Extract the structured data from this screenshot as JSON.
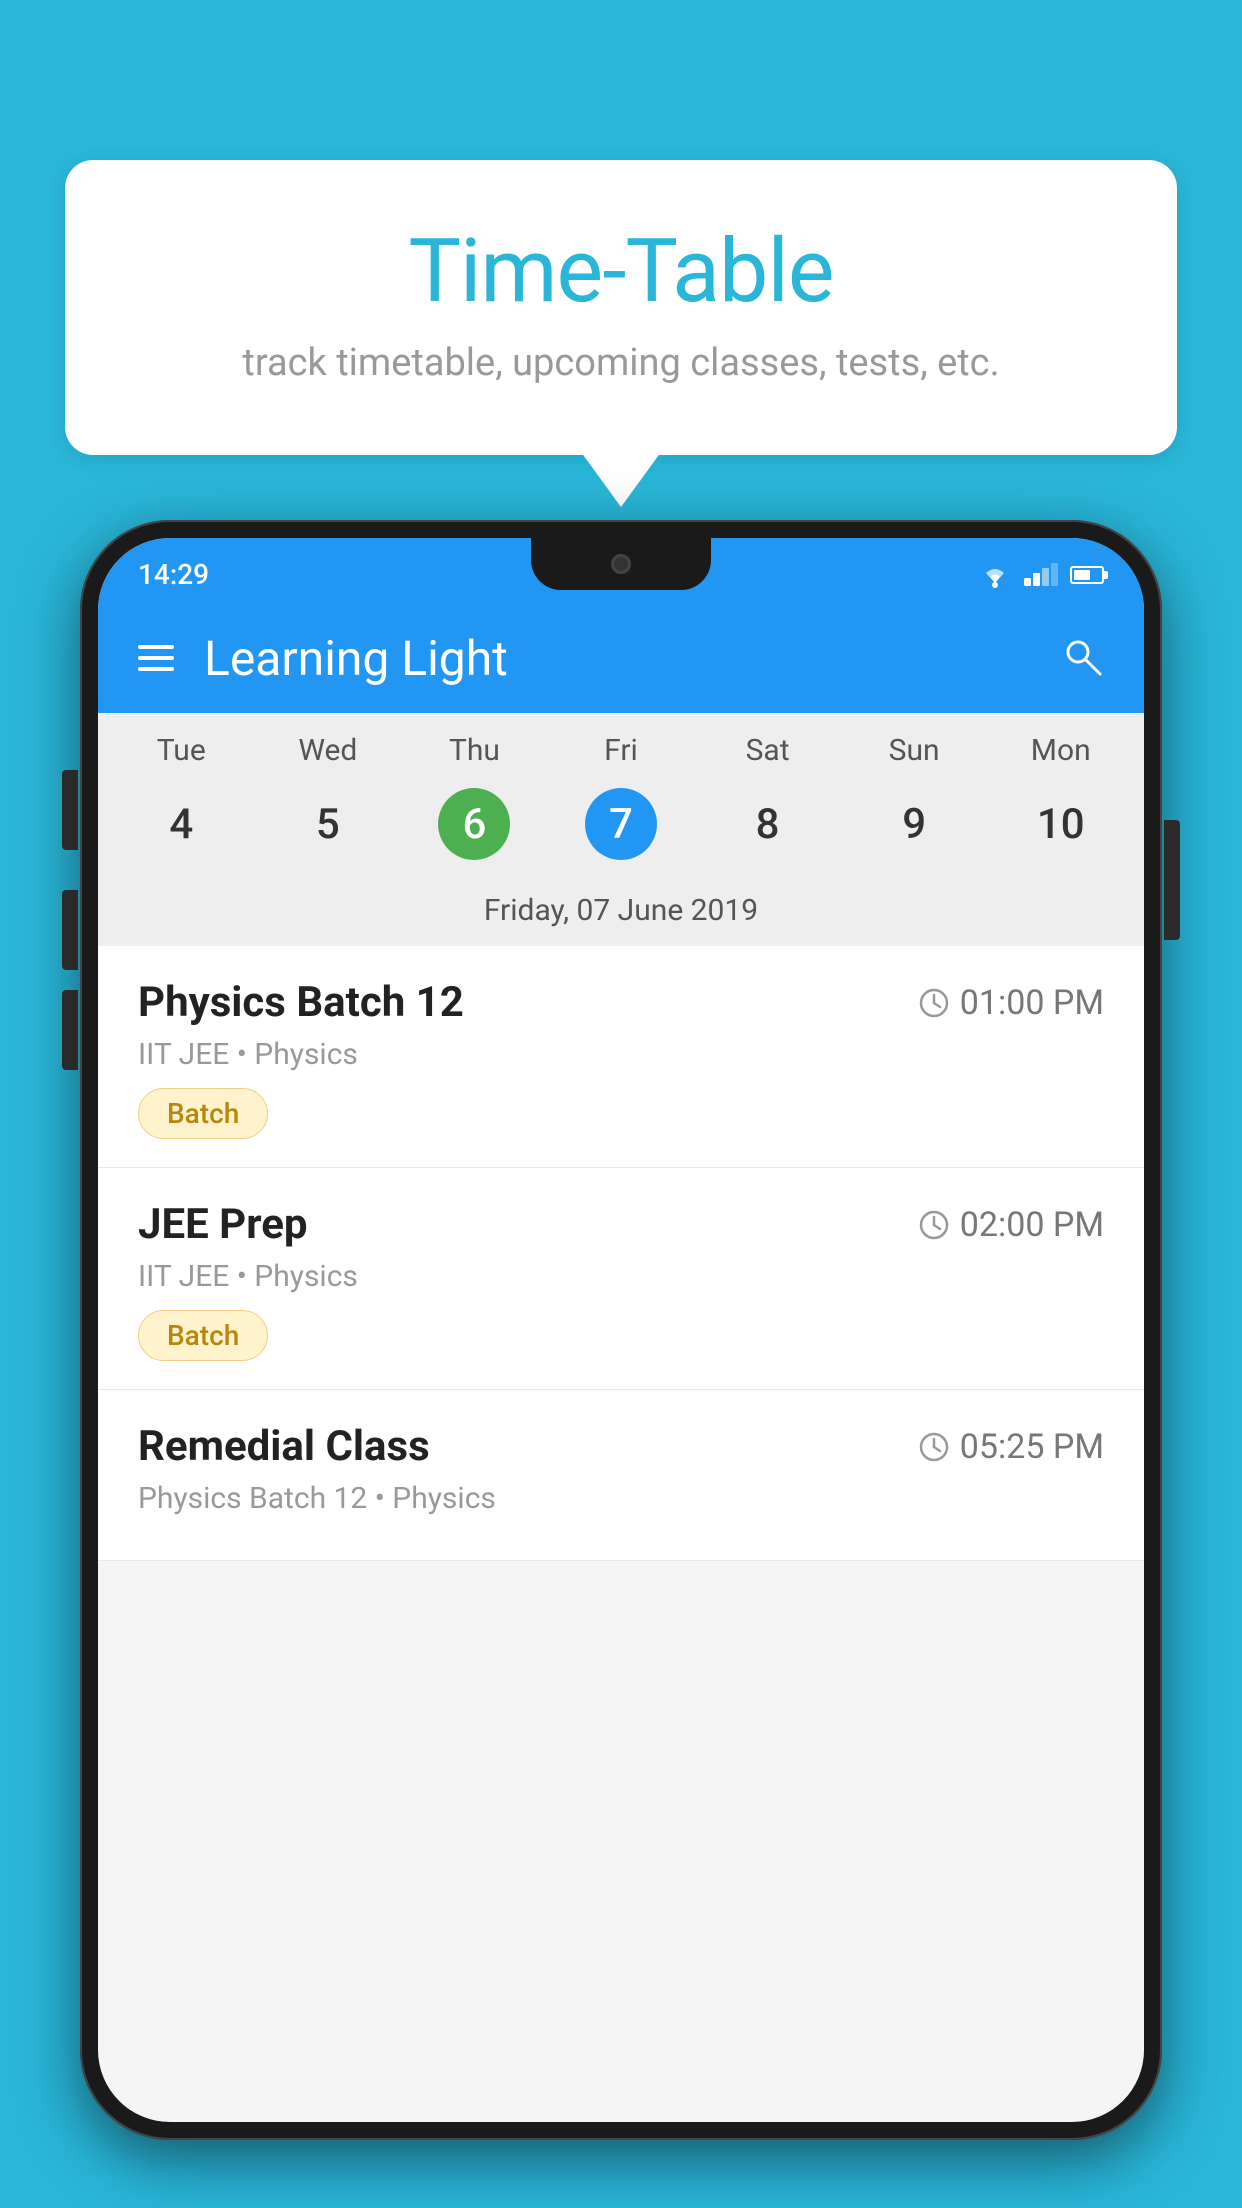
{
  "page": {
    "background_color": "#29B6D8"
  },
  "speech_bubble": {
    "title": "Time-Table",
    "subtitle": "track timetable, upcoming classes, tests, etc."
  },
  "phone": {
    "status_bar": {
      "time": "14:29"
    },
    "app_bar": {
      "title": "Learning Light"
    },
    "calendar": {
      "day_headers": [
        "Tue",
        "Wed",
        "Thu",
        "Fri",
        "Sat",
        "Sun",
        "Mon"
      ],
      "day_numbers": [
        {
          "num": "4",
          "type": "normal"
        },
        {
          "num": "5",
          "type": "normal"
        },
        {
          "num": "6",
          "type": "green"
        },
        {
          "num": "7",
          "type": "blue"
        },
        {
          "num": "8",
          "type": "normal"
        },
        {
          "num": "9",
          "type": "normal"
        },
        {
          "num": "10",
          "type": "normal"
        }
      ],
      "selected_date": "Friday, 07 June 2019"
    },
    "schedule_items": [
      {
        "title": "Physics Batch 12",
        "time": "01:00 PM",
        "subtitle": "IIT JEE • Physics",
        "badge": "Batch"
      },
      {
        "title": "JEE Prep",
        "time": "02:00 PM",
        "subtitle": "IIT JEE • Physics",
        "badge": "Batch"
      },
      {
        "title": "Remedial Class",
        "time": "05:25 PM",
        "subtitle": "Physics Batch 12 • Physics",
        "badge": null
      }
    ]
  }
}
